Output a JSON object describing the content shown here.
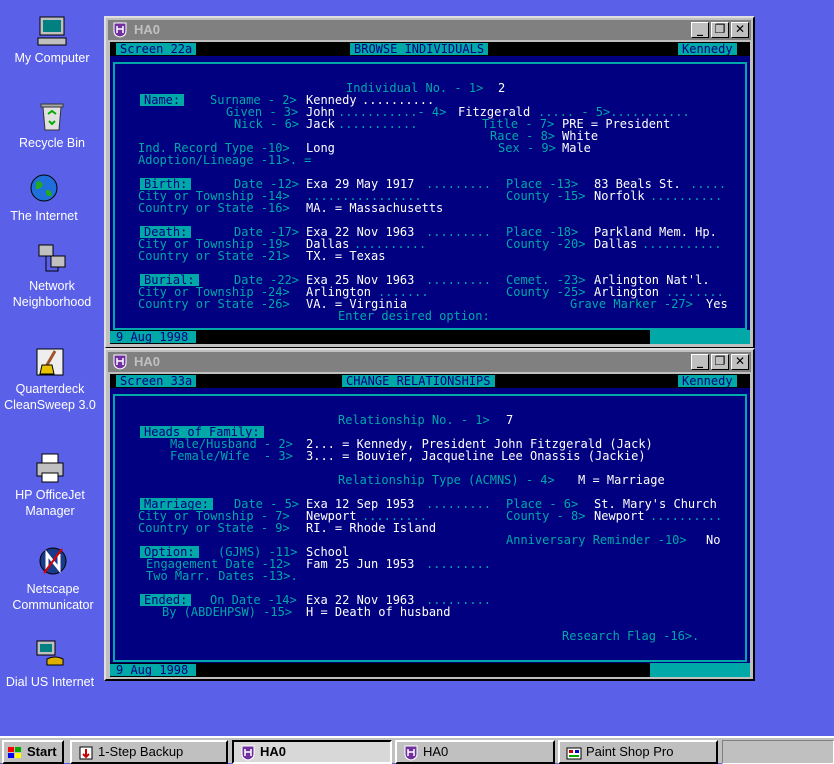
{
  "desktop": {
    "icons": [
      {
        "label": "My Computer",
        "icon": "computer-icon"
      },
      {
        "label": "Recycle Bin",
        "icon": "recycle-bin-icon"
      },
      {
        "label": "The Internet",
        "icon": "globe-icon"
      },
      {
        "label": "Network Neighborhood",
        "icon": "network-icon"
      },
      {
        "label": "Quarterdeck CleanSweep 3.0",
        "icon": "broom-icon"
      },
      {
        "label": "HP OfficeJet Manager",
        "icon": "printer-icon"
      },
      {
        "label": "Netscape Communicator",
        "icon": "netscape-icon"
      },
      {
        "label": "Dial US Internet",
        "icon": "dialup-icon"
      }
    ]
  },
  "window1": {
    "title": "HA0",
    "screen_id": "Screen 22a",
    "heading": "BROWSE INDIVIDUALS",
    "family": "Kennedy",
    "date": "9 Aug 1998",
    "lines": {
      "l01": "Individual No. - 1>",
      "l01v": "2",
      "name_hdr": "Name:",
      "surname_lbl": "Surname - 2>",
      "surname_val": "Kennedy",
      "surname_dots": "..........",
      "given_lbl": "Given - 3>",
      "given_val": "John",
      "given_dots": "...........- 4>",
      "given2_val": "Fitzgerald",
      "given2_dots": "..... - 5>...........",
      "nick_lbl": "Nick - 6>",
      "nick_val": "Jack",
      "nick_dots": "...........",
      "title_lbl": "Title - 7>",
      "title_val": "PRE = President",
      "race_lbl": "Race - 8>",
      "race_val": "White",
      "indtype_lbl": "Ind. Record Type -10>",
      "indtype_val": "Long",
      "sex_lbl": "Sex - 9>",
      "sex_val": "Male",
      "adopt_lbl": "Adoption/Lineage -11>. =",
      "birth_hdr": "Birth:",
      "birth_date_lbl": "Date -12>",
      "birth_date_val": "Exa 29 May 1917",
      "birth_date_dots": ".........",
      "birth_place_lbl": "Place -13>",
      "birth_place_val": "83 Beals St.",
      "birth_place_dots": ".....",
      "birth_city_lbl": "City or Township -14>",
      "birth_city_dots": "................",
      "birth_county_lbl": "County -15>",
      "birth_county_val": "Norfolk",
      "birth_county_dots": "..........",
      "birth_state_lbl": "Country or State -16>",
      "birth_state_val": "MA. = Massachusetts",
      "death_hdr": "Death:",
      "death_date_lbl": "Date -17>",
      "death_date_val": "Exa 22 Nov 1963",
      "death_date_dots": ".........",
      "death_place_lbl": "Place -18>",
      "death_place_val": "Parkland Mem. Hp.",
      "death_city_lbl": "City or Township -19>",
      "death_city_val": "Dallas",
      "death_city_dots": "..........",
      "death_county_lbl": "County -20>",
      "death_county_val": "Dallas",
      "death_county_dots": "...........",
      "death_state_lbl": "Country or State -21>",
      "death_state_val": "TX. = Texas",
      "burial_hdr": "Burial:",
      "burial_date_lbl": "Date -22>",
      "burial_date_val": "Exa 25 Nov 1963",
      "burial_date_dots": ".........",
      "cemet_lbl": "Cemet. -23>",
      "cemet_val": "Arlington Nat'l.",
      "burial_city_lbl": "City or Township -24>",
      "burial_city_val": "Arlington",
      "burial_city_dots": ".......",
      "burial_county_lbl": "County -25>",
      "burial_county_val": "Arlington",
      "burial_county_dots": "........",
      "burial_state_lbl": "Country or State -26>",
      "burial_state_val": "VA. = Virginia",
      "grave_lbl": "Grave Marker -27>",
      "grave_val": "Yes",
      "prompt": "Enter desired option:"
    }
  },
  "window2": {
    "title": "HA0",
    "screen_id": "Screen 33a",
    "heading": "CHANGE RELATIONSHIPS",
    "family": "Kennedy",
    "date": "9 Aug 1998",
    "lines": {
      "relno_lbl": "Relationship No. - 1>",
      "relno_val": "7",
      "heads_hdr": "Heads of Family:",
      "male_lbl": "Male/Husband - 2>",
      "male_val": "2... = Kennedy, President John Fitzgerald (Jack)",
      "female_lbl": "Female/Wife  - 3>",
      "female_val": "3... = Bouvier, Jacqueline Lee Onassis (Jackie)",
      "reltype_lbl": "Relationship Type (ACMNS) - 4>",
      "reltype_val": "M = Marriage",
      "marriage_hdr": "Marriage:",
      "mar_date_lbl": "Date - 5>",
      "mar_date_val": "Exa 12 Sep 1953",
      "mar_date_dots": ".........",
      "mar_place_lbl": "Place - 6>",
      "mar_place_val": "St. Mary's Church",
      "mar_city_lbl": "City or Township - 7>",
      "mar_city_val": "Newport",
      "mar_city_dots": ".........",
      "mar_county_lbl": "County - 8>",
      "mar_county_val": "Newport",
      "mar_county_dots": "..........",
      "mar_state_lbl": "Country or State - 9>",
      "mar_state_val": "RI. = Rhode Island",
      "anniv_lbl": "Anniversary Reminder -10>",
      "anniv_val": "No",
      "option_hdr": "Option:",
      "option_lbl": "(GJMS) -11>",
      "option_val": "School",
      "engage_lbl": "Engagement Date -12>",
      "engage_val": "Fam 25 Jun 1953",
      "engage_dots": ".........",
      "twomarr_lbl": "Two Marr. Dates -13>.",
      "ended_hdr": "Ended:",
      "ended_lbl": "On Date -14>",
      "ended_val": "Exa 22 Nov 1963",
      "ended_dots": ".........",
      "by_lbl": "By (ABDEHPSW) -15>",
      "by_val": "H = Death of husband",
      "research_lbl": "Research Flag -16>."
    }
  },
  "taskbar": {
    "start_label": "Start",
    "buttons": [
      {
        "label": "1-Step Backup",
        "icon": "backup-icon"
      },
      {
        "label": "HA0",
        "icon": "ha0-icon",
        "active": true
      },
      {
        "label": "HA0",
        "icon": "ha0-icon"
      },
      {
        "label": "Paint Shop Pro",
        "icon": "paintshop-icon"
      }
    ]
  }
}
